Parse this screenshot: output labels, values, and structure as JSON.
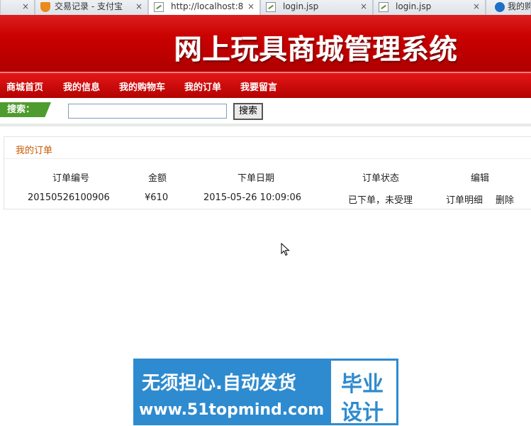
{
  "browser": {
    "tabs": [
      {
        "title": "",
        "close": "×",
        "icon": "close-only"
      },
      {
        "title": "交易记录 - 支付宝",
        "close": "×",
        "icon": "alipay-shield-icon"
      },
      {
        "title": "http://localhost:8",
        "close": "×",
        "icon": "page-icon"
      },
      {
        "title": "login.jsp",
        "close": "×",
        "icon": "page-icon"
      },
      {
        "title": "login.jsp",
        "close": "×",
        "icon": "page-icon"
      },
      {
        "title": "我的购",
        "close": "",
        "icon": "ie-icon"
      }
    ]
  },
  "header": {
    "title": "网上玩具商城管理系统"
  },
  "nav": {
    "items": [
      "商城首页",
      "我的信息",
      "我的购物车",
      "我的订单",
      "我要留言"
    ]
  },
  "search": {
    "label": "搜索：",
    "value": "",
    "placeholder": "",
    "button": "搜索"
  },
  "orders": {
    "title": "我的订单",
    "columns": [
      "订单编号",
      "金额",
      "下单日期",
      "订单状态",
      "编辑"
    ],
    "rows": [
      {
        "id": "20150526100906",
        "amount": "¥610",
        "date": "2015-05-26 10:09:06",
        "status": "已下单，未受理",
        "actions": [
          "订单明细",
          "删除"
        ]
      }
    ]
  },
  "watermark": {
    "line1": "无须担心.自动发货",
    "line2": "www.51topmind.com",
    "side1": "毕业",
    "side2": "设计"
  },
  "colors": {
    "header_red": "#c70000",
    "nav_red": "#cc0000",
    "search_green": "#4e9c2e",
    "panel_title": "#c85a00",
    "banner_blue": "#2e8bcf"
  }
}
